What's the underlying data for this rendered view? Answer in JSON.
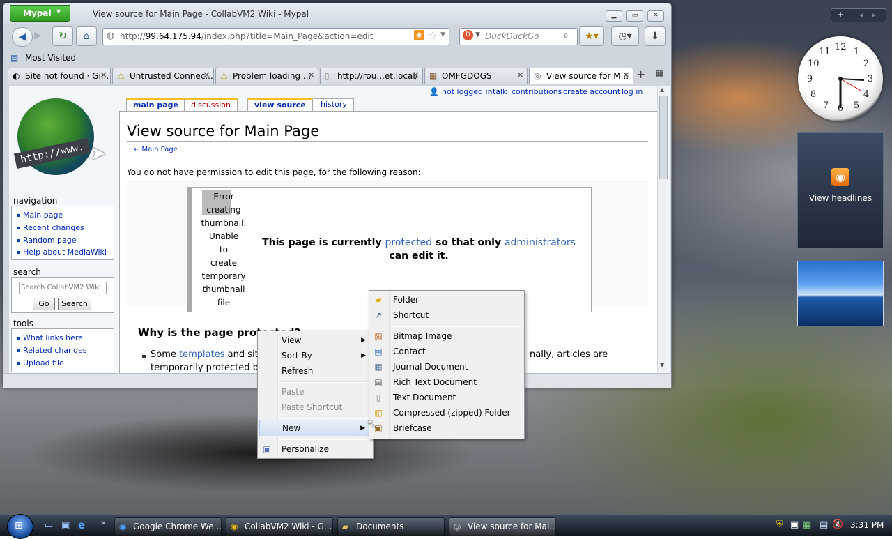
{
  "window": {
    "app_button": "Mypal",
    "title": "View source for Main Page - CollabVM2 Wiki - Mypal"
  },
  "navbar": {
    "url_prefix": "http://",
    "url_host": "99.64.175.94",
    "url_path": "/index.php?title=Main_Page&action=edit",
    "search_placeholder": "DuckDuckGo"
  },
  "bookmarks": {
    "most_visited": "Most Visited"
  },
  "tabs": [
    {
      "label": "Site not found · Gi...",
      "icon": "github-icon"
    },
    {
      "label": "Untrusted Connec...",
      "icon": "warning-icon"
    },
    {
      "label": "Problem loading ...",
      "icon": "warning-icon"
    },
    {
      "label": "http://rou...et.local/",
      "icon": "page-icon"
    },
    {
      "label": "OMFGDOGS",
      "icon": "dogs-icon"
    },
    {
      "label": "View source for M...",
      "icon": "page-icon"
    }
  ],
  "wiki": {
    "user_links": [
      "not logged in",
      "talk",
      "contributions",
      "create account",
      "log in"
    ],
    "page_tabs": [
      "main page",
      "discussion",
      "view source",
      "history"
    ],
    "logo_text": "http://www.",
    "nav_heading": "navigation",
    "nav_items": [
      "Main page",
      "Recent changes",
      "Random page",
      "Help about MediaWiki"
    ],
    "search_heading": "search",
    "search_placeholder": "Search CollabVM2 Wiki",
    "go_button": "Go",
    "search_button": "Search",
    "tools_heading": "tools",
    "tools_items": [
      "What links here",
      "Related changes",
      "Upload file"
    ],
    "title": "View source for Main Page",
    "back_link": "← Main Page",
    "permission_text": "You do not have permission to edit this page, for the following reason:",
    "thumb_error_lines": [
      "Error",
      "creating",
      "thumbnail:",
      "Unable",
      "to",
      "create",
      "temporary",
      "thumbnail",
      "file"
    ],
    "protected_pre": "This page is currently",
    "protected_link1": "protected",
    "protected_mid": "so that only",
    "protected_link2": "administrators",
    "protected_post": "can edit it.",
    "why_heading": "Why is the page protected?",
    "bullet_pre": "Some",
    "bullet_link": "templates",
    "bullet_mid": "and site in",
    "bullet_line2": "temporarily protected beca",
    "bullet_tail": "nally, articles are"
  },
  "context_menu": {
    "items": [
      {
        "label": "View",
        "submenu": true
      },
      {
        "label": "Sort By",
        "submenu": true
      },
      {
        "label": "Refresh"
      },
      {
        "label": "Paste",
        "disabled": true
      },
      {
        "label": "Paste Shortcut",
        "disabled": true
      },
      {
        "label": "New",
        "submenu": true,
        "highlighted": true
      },
      {
        "label": "Personalize",
        "icon": "personalize-icon"
      }
    ]
  },
  "new_submenu": {
    "items": [
      {
        "label": "Folder",
        "icon": "folder-icon"
      },
      {
        "label": "Shortcut",
        "icon": "shortcut-icon"
      },
      {
        "label": "Bitmap Image",
        "icon": "bitmap-icon"
      },
      {
        "label": "Contact",
        "icon": "contact-icon"
      },
      {
        "label": "Journal Document",
        "icon": "journal-icon"
      },
      {
        "label": "Rich Text Document",
        "icon": "richtext-icon"
      },
      {
        "label": "Text Document",
        "icon": "textdoc-icon"
      },
      {
        "label": "Compressed (zipped) Folder",
        "icon": "zip-folder-icon"
      },
      {
        "label": "Briefcase",
        "icon": "briefcase-icon"
      }
    ]
  },
  "gadgets": {
    "feed_label": "View headlines",
    "clock_numbers": [
      "12",
      "1",
      "2",
      "3",
      "4",
      "5",
      "6",
      "7",
      "8",
      "9",
      "10",
      "11"
    ]
  },
  "taskbar": {
    "buttons": [
      {
        "label": "Google Chrome We...",
        "icon": "chrome-icon"
      },
      {
        "label": "CollabVM2 Wiki - G...",
        "icon": "chrome-icon"
      },
      {
        "label": "Documents",
        "icon": "folder-icon"
      },
      {
        "label": "View source for Mai...",
        "icon": "mypal-icon"
      }
    ],
    "time": "3:31 PM"
  }
}
